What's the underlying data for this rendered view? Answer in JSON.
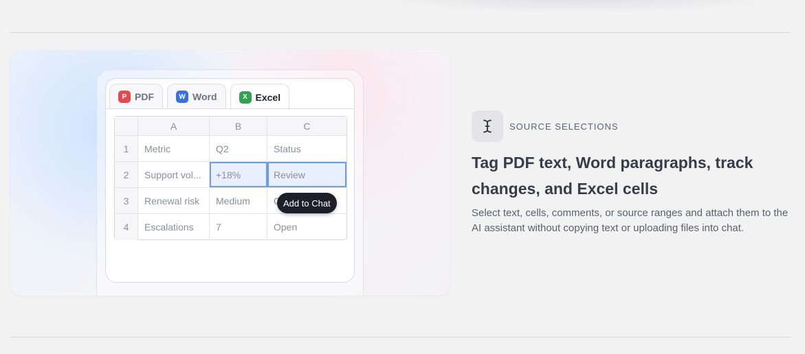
{
  "tabs": [
    {
      "badge": "P",
      "label": "PDF",
      "color": "#e5484d"
    },
    {
      "badge": "W",
      "label": "Word",
      "color": "#3b6fe0"
    },
    {
      "badge": "X",
      "label": "Excel",
      "color": "#2ea44f"
    }
  ],
  "sheet": {
    "columns": [
      "A",
      "B",
      "C"
    ],
    "rows": [
      {
        "num": "1",
        "a": "Metric",
        "b": "Q2",
        "c": "Status"
      },
      {
        "num": "2",
        "a": "Support vol...",
        "b": "+18%",
        "c": "Review"
      },
      {
        "num": "3",
        "a": "Renewal risk",
        "b": "Medium",
        "c": "O"
      },
      {
        "num": "4",
        "a": "Escalations",
        "b": "7",
        "c": "Open"
      }
    ]
  },
  "tooltip": {
    "label": "Add to Chat"
  },
  "feature": {
    "icon": "text-cursor-icon",
    "eyebrow": "SOURCE SELECTIONS",
    "title": "Tag PDF text, Word paragraphs, track changes, and Excel cells",
    "description": "Select text, cells, comments, or source ranges and attach them to the AI assistant without copying text or uploading files into chat."
  }
}
